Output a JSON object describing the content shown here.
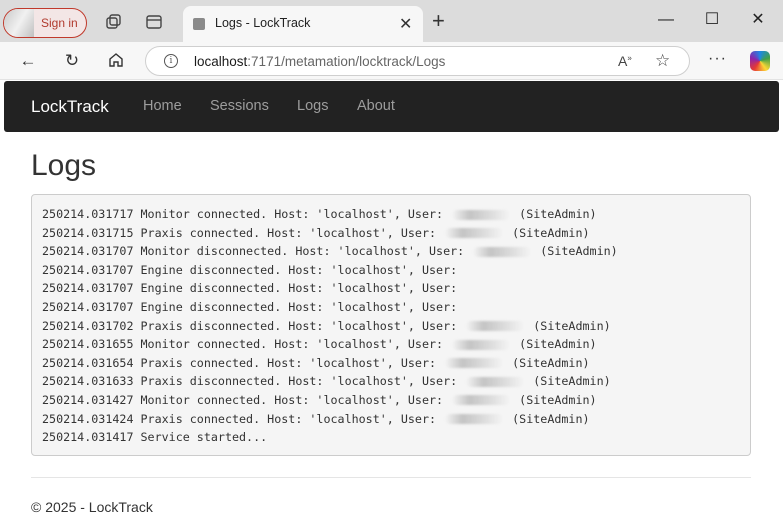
{
  "browser": {
    "signin_label": "Sign in",
    "tab_title": "Logs - LockTrack",
    "url_host": "localhost",
    "url_path": ":7171/metamation/locktrack/Logs"
  },
  "navbar": {
    "brand": "LockTrack",
    "links": [
      "Home",
      "Sessions",
      "Logs",
      "About"
    ]
  },
  "main": {
    "title": "Logs",
    "log_lines": [
      {
        "before": "250214.031717 Monitor connected. Host: 'localhost', User: ",
        "after": " (SiteAdmin)",
        "redacted": true
      },
      {
        "before": "250214.031715 Praxis connected. Host: 'localhost', User: ",
        "after": " (SiteAdmin)",
        "redacted": true
      },
      {
        "before": "250214.031707 Monitor disconnected. Host: 'localhost', User: ",
        "after": " (SiteAdmin)",
        "redacted": true
      },
      {
        "before": "250214.031707 Engine disconnected. Host: 'localhost', User:",
        "after": "",
        "redacted": false
      },
      {
        "before": "250214.031707 Engine disconnected. Host: 'localhost', User:",
        "after": "",
        "redacted": false
      },
      {
        "before": "250214.031707 Engine disconnected. Host: 'localhost', User:",
        "after": "",
        "redacted": false
      },
      {
        "before": "250214.031702 Praxis disconnected. Host: 'localhost', User: ",
        "after": " (SiteAdmin)",
        "redacted": true
      },
      {
        "before": "250214.031655 Monitor connected. Host: 'localhost', User: ",
        "after": " (SiteAdmin)",
        "redacted": true
      },
      {
        "before": "250214.031654 Praxis connected. Host: 'localhost', User: ",
        "after": " (SiteAdmin)",
        "redacted": true
      },
      {
        "before": "250214.031633 Praxis disconnected. Host: 'localhost', User: ",
        "after": " (SiteAdmin)",
        "redacted": true
      },
      {
        "before": "250214.031427 Monitor connected. Host: 'localhost', User: ",
        "after": " (SiteAdmin)",
        "redacted": true
      },
      {
        "before": "250214.031424 Praxis connected. Host: 'localhost', User: ",
        "after": " (SiteAdmin)",
        "redacted": true
      },
      {
        "before": "250214.031417 Service started...",
        "after": "",
        "redacted": false
      }
    ]
  },
  "footer": {
    "text": "© 2025 - LockTrack"
  },
  "colors": {
    "navbar_bg": "#222222",
    "brand_text": "#ffffff",
    "nav_link": "#9d9d9d",
    "log_bg": "#f5f5f5"
  },
  "icons": [
    "workspaces-icon",
    "vertical-tabs-icon",
    "tab-favicon",
    "close-icon",
    "new-tab-icon",
    "minimize-icon",
    "maximize-icon",
    "window-close-icon",
    "back-icon",
    "refresh-icon",
    "home-icon",
    "site-info-icon",
    "read-aloud-icon",
    "favorite-star-icon",
    "more-icon",
    "copilot-icon"
  ]
}
